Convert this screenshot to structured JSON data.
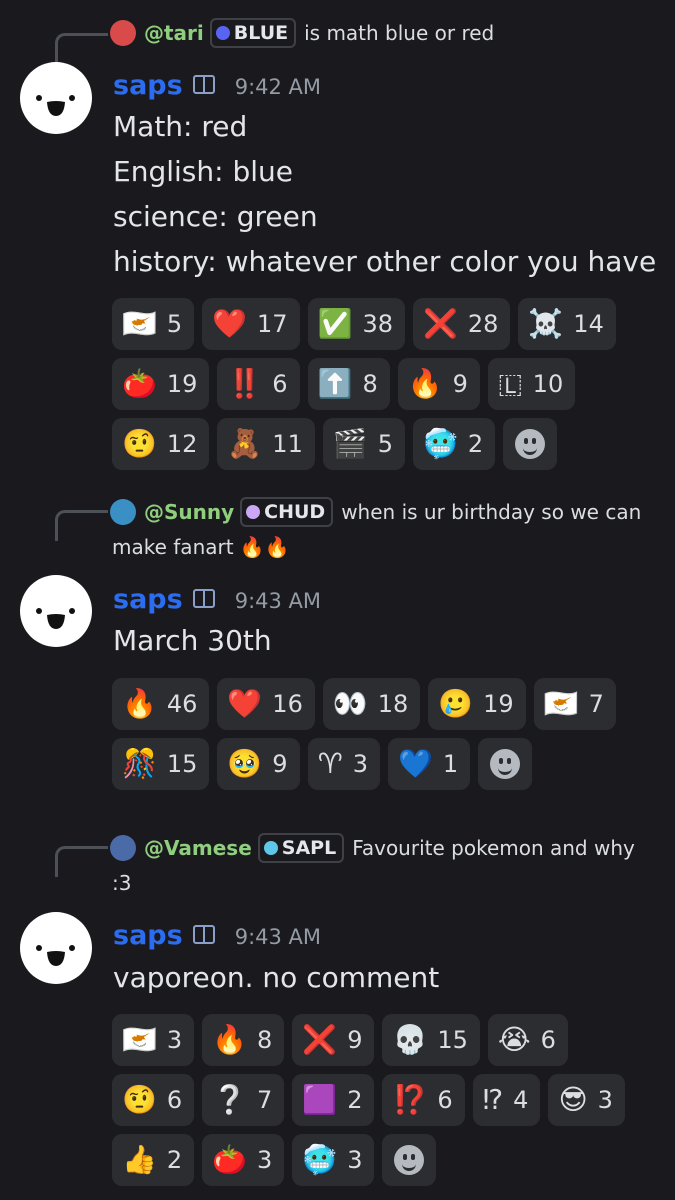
{
  "messages": [
    {
      "reply": {
        "username": "@tari",
        "role": "BLUE",
        "role_color": "#5865f2",
        "text": "is math blue or red"
      },
      "author": "saps",
      "time": "9:42 AM",
      "lines": [
        "Math: red",
        "English: blue",
        "science: green",
        "history: whatever other color you have"
      ],
      "reactions": [
        [
          {
            "emoji": "🇨🇾",
            "count": "5"
          },
          {
            "emoji": "❤️",
            "count": "17"
          },
          {
            "emoji": "✅",
            "count": "38"
          },
          {
            "emoji": "❌",
            "count": "28"
          },
          {
            "emoji": "☠️",
            "count": "14"
          }
        ],
        [
          {
            "emoji": "🍅",
            "count": "19"
          },
          {
            "emoji": "‼️",
            "count": "6"
          },
          {
            "emoji": "⬆️",
            "count": "8"
          },
          {
            "emoji": "🔥",
            "count": "9"
          },
          {
            "emoji": "🇱",
            "count": "10"
          }
        ],
        [
          {
            "emoji": "🤨",
            "count": "12"
          },
          {
            "emoji": "🧸",
            "count": "11"
          },
          {
            "emoji": "🎬",
            "count": "5"
          },
          {
            "emoji": "🥶",
            "count": "2"
          }
        ]
      ]
    },
    {
      "reply": {
        "username": "@Sunny",
        "role": "CHUD",
        "role_color": "#c9a7f5",
        "text": "when is ur birthday so we can",
        "text2": "make fanart 🔥🔥"
      },
      "author": "saps",
      "time": "9:43 AM",
      "lines": [
        "March 30th"
      ],
      "reactions": [
        [
          {
            "emoji": "🔥",
            "count": "46"
          },
          {
            "emoji": "❤️",
            "count": "16"
          },
          {
            "emoji": "👀",
            "count": "18"
          },
          {
            "emoji": "🥲",
            "count": "19"
          },
          {
            "emoji": "🇨🇾",
            "count": "7"
          }
        ],
        [
          {
            "emoji": "🎊",
            "count": "15"
          },
          {
            "emoji": "🥹",
            "count": "9"
          },
          {
            "emoji": "♈",
            "count": "3"
          },
          {
            "emoji": "💙",
            "count": "1"
          }
        ]
      ]
    },
    {
      "reply": {
        "username": "@Vamese",
        "role": "SAPL",
        "role_color": "#5ec6e8",
        "text": "Favourite pokemon and why",
        "text2": ":3"
      },
      "author": "saps",
      "time": "9:43 AM",
      "lines": [
        "vaporeon. no comment"
      ],
      "reactions": [
        [
          {
            "emoji": "🇨🇾",
            "count": "3"
          },
          {
            "emoji": "🔥",
            "count": "8"
          },
          {
            "emoji": "❌",
            "count": "9"
          },
          {
            "emoji": "💀",
            "count": "15"
          },
          {
            "emoji": "😭",
            "count": "6"
          }
        ],
        [
          {
            "emoji": "🤨",
            "count": "6"
          },
          {
            "emoji": "❔",
            "count": "7"
          },
          {
            "emoji": "🟪",
            "count": "2"
          },
          {
            "emoji": "⁉️",
            "count": "6"
          },
          {
            "emoji": "⁉",
            "count": "4"
          },
          {
            "emoji": "😎",
            "count": "3"
          }
        ],
        [
          {
            "emoji": "👍",
            "count": "2"
          },
          {
            "emoji": "🍅",
            "count": "3"
          },
          {
            "emoji": "🥶",
            "count": "3"
          }
        ]
      ]
    }
  ]
}
